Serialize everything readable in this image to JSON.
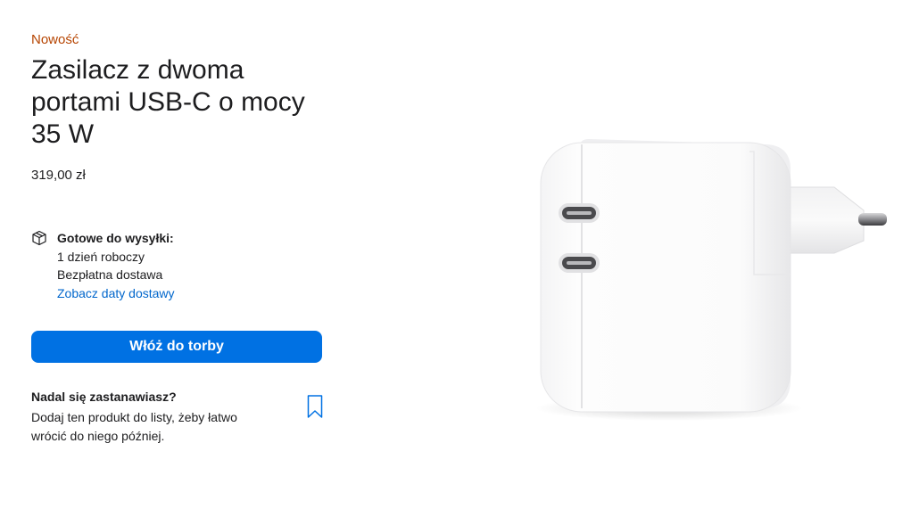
{
  "product": {
    "badge": "Nowość",
    "title": "Zasilacz z dwoma portami USB-C o mocy 35 W",
    "price": "319,00 zł"
  },
  "shipping": {
    "icon": "box-icon",
    "heading": "Gotowe do wysyłki:",
    "lines": [
      "1 dzień roboczy",
      "Bezpłatna dostawa"
    ],
    "link_label": "Zobacz daty dostawy"
  },
  "actions": {
    "add_to_bag_label": "Włóż do torby"
  },
  "save_for_later": {
    "heading": "Nadal się zastanawiasz?",
    "description": "Dodaj ten produkt do listy, żeby łatwo wrócić do niego później.",
    "icon": "bookmark-icon"
  },
  "colors": {
    "badge": "#b64400",
    "link": "#0066cc",
    "button": "#0071e3",
    "text": "#1d1d1f"
  }
}
